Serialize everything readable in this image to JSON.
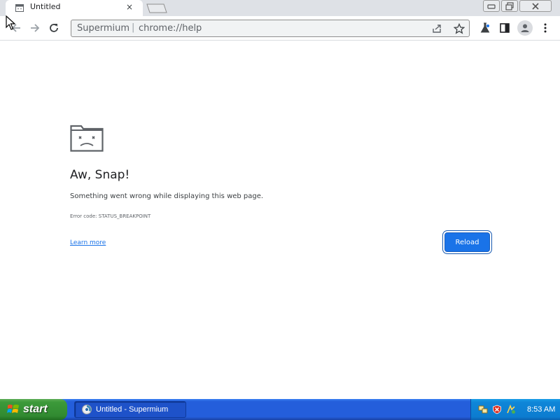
{
  "tab": {
    "title": "Untitled",
    "close_glyph": "×",
    "favicon": "sad-page-icon"
  },
  "window_controls": {
    "minimize": "minimize-icon",
    "restore": "restore-icon",
    "close": "close-icon"
  },
  "toolbar": {
    "back": "back-arrow-icon",
    "forward": "forward-arrow-icon",
    "reload": "reload-icon",
    "omnibox": {
      "host": "Supermium",
      "separator": "|",
      "url": "chrome://help"
    },
    "share": "share-icon",
    "bookmark": "star-icon",
    "labs": "flask-icon",
    "side_panel": "side-panel-icon",
    "profile": "profile-icon",
    "menu": "kebab-menu-icon"
  },
  "page": {
    "icon": "sad-folder-icon",
    "title": "Aw, Snap!",
    "message": "Something went wrong while displaying this web page.",
    "error_code": "Error code: STATUS_BREAKPOINT",
    "learn_more": "Learn more",
    "reload_label": "Reload",
    "accent": "#1a73e8"
  },
  "taskbar": {
    "start_label": "start",
    "task_label": "Untitled - Supermium",
    "clock": "8:53 AM",
    "tray_icons": [
      "network-icon",
      "security-shield-icon",
      "update-icon"
    ],
    "colors": {
      "taskbar": "#245edb",
      "start": "#3c9a3a",
      "tray": "#0f86d8"
    }
  }
}
